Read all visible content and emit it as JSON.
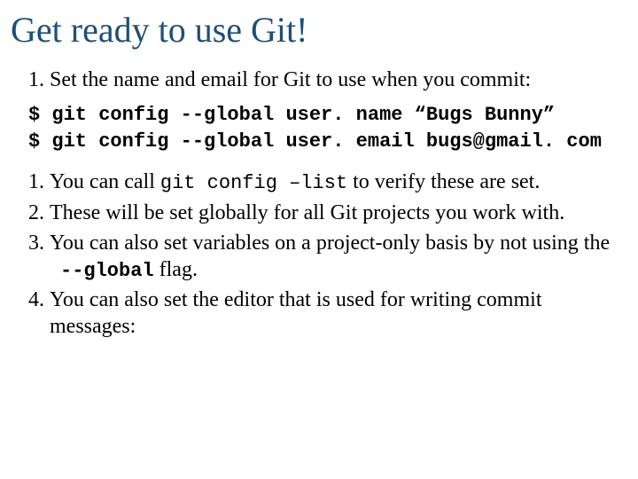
{
  "title": "Get ready to use Git!",
  "intro": {
    "item1": "Set the name and email  for Git to use when you commit:"
  },
  "code": {
    "line1": "$ git config --global user. name “Bugs Bunny”",
    "line2": "$ git config --global user. email bugs@gmail. com"
  },
  "points": {
    "p1_a": "You can call ",
    "p1_code": "git config –list",
    "p1_b": " to verify these are set.",
    "p2": "These will be set globally for all Git projects you work with.",
    "p3_a": "You can also set variables on a project-only basis by not using the",
    "p3_code": "--global",
    "p3_b": " flag.",
    "p4": "You can also set the editor that is used for writing commit messages:"
  }
}
